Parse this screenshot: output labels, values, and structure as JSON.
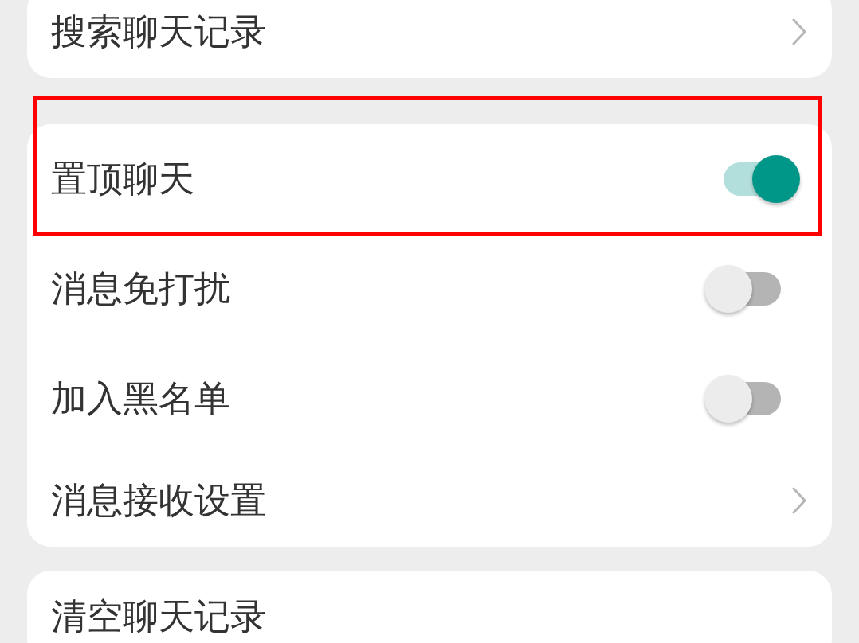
{
  "sections": [
    {
      "rows": [
        {
          "kind": "link",
          "label": "搜索聊天记录",
          "highlighted": false,
          "divider_above": false
        }
      ]
    },
    {
      "rows": [
        {
          "kind": "toggle",
          "label": "置顶聊天",
          "on": true,
          "highlighted": true,
          "divider_above": false
        },
        {
          "kind": "toggle",
          "label": "消息免打扰",
          "on": false,
          "highlighted": false,
          "divider_above": false
        },
        {
          "kind": "toggle",
          "label": "加入黑名单",
          "on": false,
          "highlighted": false,
          "divider_above": false
        },
        {
          "kind": "link",
          "label": "消息接收设置",
          "highlighted": false,
          "divider_above": true
        }
      ]
    },
    {
      "rows": [
        {
          "kind": "action",
          "label": "清空聊天记录",
          "highlighted": false,
          "divider_above": false
        }
      ]
    }
  ]
}
